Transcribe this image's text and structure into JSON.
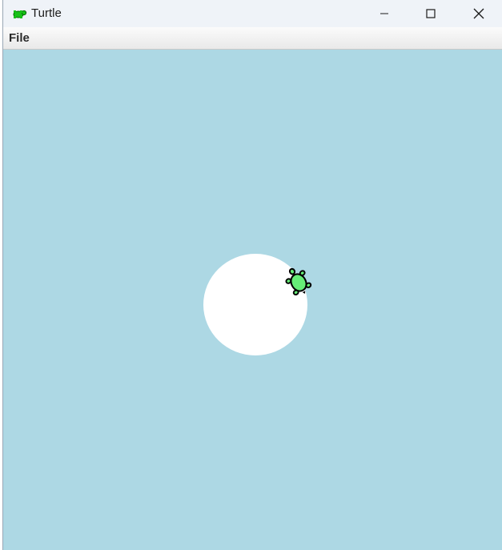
{
  "window": {
    "title": "Turtle",
    "app_icon": "turtle-icon",
    "controls": {
      "minimize": "minimize-icon",
      "maximize": "maximize-icon",
      "close": "close-icon"
    }
  },
  "menubar": {
    "items": [
      {
        "label": "File"
      }
    ]
  },
  "canvas": {
    "background_color": "#add8e4",
    "shapes": [
      {
        "type": "circle",
        "fill": "#ffffff"
      }
    ],
    "turtle": {
      "shape": "turtle",
      "fill": "#66ee77",
      "outline": "#000000"
    }
  }
}
